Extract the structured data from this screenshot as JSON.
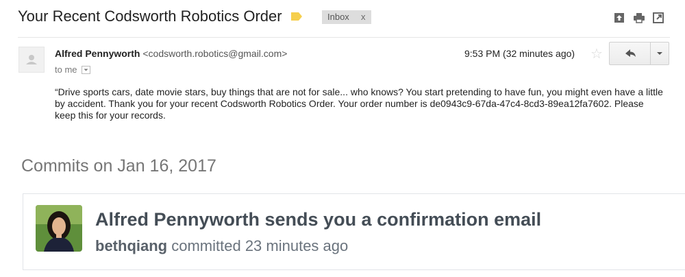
{
  "email": {
    "subject": "Your Recent Codsworth Robotics Order",
    "label_chip": "Inbox",
    "label_chip_close": "x",
    "sender_name": "Alfred Pennyworth",
    "sender_email": "<codsworth.robotics@gmail.com>",
    "to_line": "to me",
    "time": "9:53 PM (32 minutes ago)",
    "body": "“Drive sports cars, date movie stars, buy things that are not for sale... who knows? You start pretending to have fun, you might even have a little by accident. Thank you for your recent Codsworth Robotics Order. Your order number is de0943c9-67da-47c4-8cd3-89ea12fa7602. Please keep this for your records.",
    "icons": [
      "label-icon",
      "print-all-icon",
      "print-icon",
      "new-window-icon",
      "star-icon",
      "reply-icon",
      "more-options-icon",
      "sender-avatar-icon"
    ],
    "colors": {
      "label": "#f6cf4d",
      "chip_bg": "#dddddd"
    }
  },
  "github": {
    "heading": "Commits on Jan 16, 2017",
    "commit_title": "Alfred Pennyworth sends you a confirmation email",
    "author": "bethqiang",
    "committed_text": "committed 23 minutes ago"
  }
}
